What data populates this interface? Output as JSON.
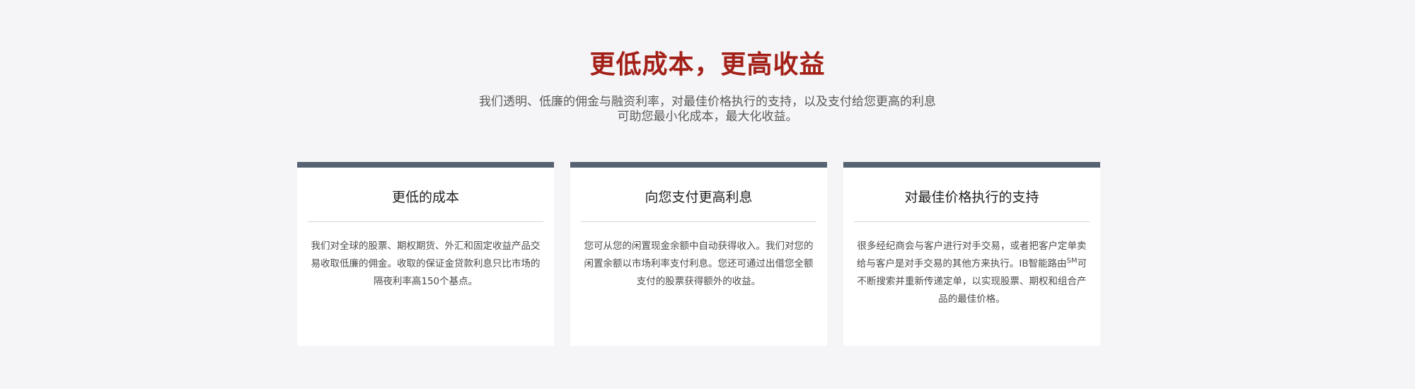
{
  "header": {
    "title": "更低成本，更高收益",
    "subtitle_line1": "我们透明、低廉的佣金与融资利率，对最佳价格执行的支持，以及支付给您更高的利息",
    "subtitle_line2": "可助您最小化成本，最大化收益。"
  },
  "cards": [
    {
      "title": "更低的成本",
      "text": "我们对全球的股票、期权期货、外汇和固定收益产品交易收取低廉的佣金。收取的保证金贷款利息只比市场的隔夜利率高150个基点。"
    },
    {
      "title": "向您支付更高利息",
      "text": "您可从您的闲置现金余额中自动获得收入。我们对您的闲置余额以市场利率支付利息。您还可通过出借您全额支付的股票获得额外的收益。"
    },
    {
      "title": "对最佳价格执行的支持",
      "text_before": "很多经纪商会与客户进行对手交易，或者把客户定单卖给与客户是对手交易的其他方来执行。IB智能路由",
      "sup": "SM",
      "text_after": "可不断搜索并重新传递定单，以实现股票、期权和组合产品的最佳价格。"
    }
  ],
  "colors": {
    "title": "#a32018",
    "card_top_bar": "#566272",
    "background": "#f5f4f6"
  }
}
